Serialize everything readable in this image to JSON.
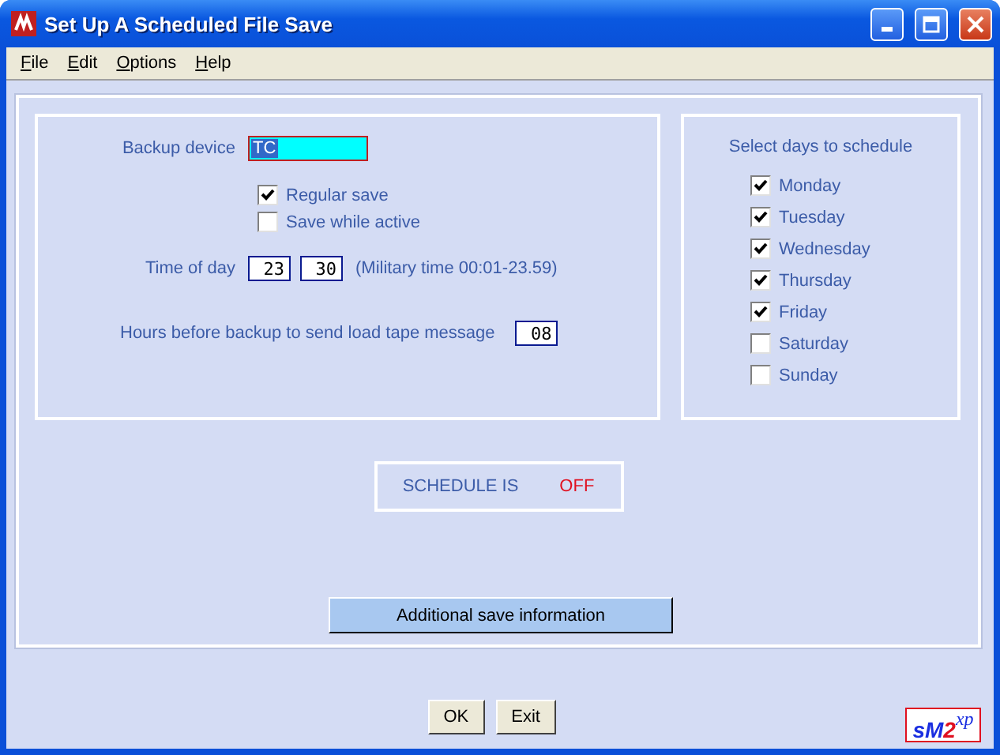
{
  "window": {
    "title": "Set Up A Scheduled File Save"
  },
  "menu": [
    {
      "label": "File"
    },
    {
      "label": "Edit"
    },
    {
      "label": "Options"
    },
    {
      "label": "Help"
    }
  ],
  "backup_device": {
    "label": "Backup device",
    "value": "TC",
    "value_selected": true
  },
  "options": [
    {
      "label": "Regular save",
      "checked": true
    },
    {
      "label": "Save while active",
      "checked": false
    }
  ],
  "time_of_day": {
    "label": "Time of day",
    "hour": "23",
    "minute": "30",
    "hint": "(Military time 00:01-23.59)"
  },
  "hours_before": {
    "label": "Hours before backup to send load tape message",
    "value": "08"
  },
  "days": {
    "title": "Select days to schedule",
    "items": [
      {
        "label": "Monday",
        "checked": true
      },
      {
        "label": "Tuesday",
        "checked": true
      },
      {
        "label": "Wednesday",
        "checked": true
      },
      {
        "label": "Thursday",
        "checked": true
      },
      {
        "label": "Friday",
        "checked": true
      },
      {
        "label": "Saturday",
        "checked": false
      },
      {
        "label": "Sunday",
        "checked": false
      }
    ]
  },
  "schedule": {
    "label": "SCHEDULE IS",
    "status": "OFF"
  },
  "additional_button": "Additional save information",
  "buttons": [
    "OK",
    "Exit"
  ],
  "logo": [
    {
      "text": "s",
      "color": "#1a2ee0"
    },
    {
      "text": "M",
      "color": "#1a2ee0"
    },
    {
      "text": "2",
      "color": "#e01020"
    },
    {
      "text": "xp",
      "color": "#1a2ee0"
    }
  ]
}
